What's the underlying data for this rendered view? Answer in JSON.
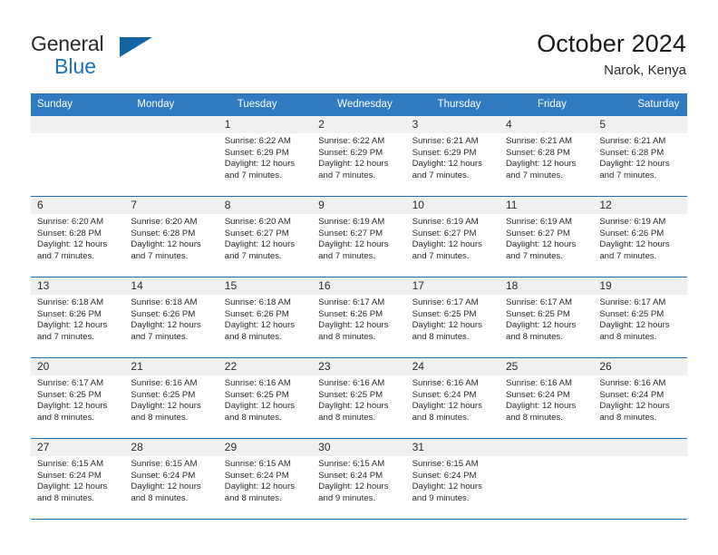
{
  "brand": {
    "name_part1": "General",
    "name_part2": "Blue",
    "triangle_icon": "blue-triangle-logo-mark",
    "accent_color": "#1d72b8"
  },
  "header": {
    "title": "October 2024",
    "subtitle": "Narok, Kenya"
  },
  "theme": {
    "header_row_color": "#2f7ac1",
    "row_divider_color": "#1f6fb5",
    "date_band_color": "#f0f0f0",
    "text_color": "#2b2b2b"
  },
  "weekday_headers": [
    "Sunday",
    "Monday",
    "Tuesday",
    "Wednesday",
    "Thursday",
    "Friday",
    "Saturday"
  ],
  "weeks": [
    [
      {
        "day": "",
        "empty": true,
        "sunrise": "",
        "sunset": "",
        "daylight1": "",
        "daylight2": ""
      },
      {
        "day": "",
        "empty": true,
        "sunrise": "",
        "sunset": "",
        "daylight1": "",
        "daylight2": ""
      },
      {
        "day": "1",
        "sunrise": "Sunrise: 6:22 AM",
        "sunset": "Sunset: 6:29 PM",
        "daylight1": "Daylight: 12 hours",
        "daylight2": "and 7 minutes."
      },
      {
        "day": "2",
        "sunrise": "Sunrise: 6:22 AM",
        "sunset": "Sunset: 6:29 PM",
        "daylight1": "Daylight: 12 hours",
        "daylight2": "and 7 minutes."
      },
      {
        "day": "3",
        "sunrise": "Sunrise: 6:21 AM",
        "sunset": "Sunset: 6:29 PM",
        "daylight1": "Daylight: 12 hours",
        "daylight2": "and 7 minutes."
      },
      {
        "day": "4",
        "sunrise": "Sunrise: 6:21 AM",
        "sunset": "Sunset: 6:28 PM",
        "daylight1": "Daylight: 12 hours",
        "daylight2": "and 7 minutes."
      },
      {
        "day": "5",
        "sunrise": "Sunrise: 6:21 AM",
        "sunset": "Sunset: 6:28 PM",
        "daylight1": "Daylight: 12 hours",
        "daylight2": "and 7 minutes."
      }
    ],
    [
      {
        "day": "6",
        "sunrise": "Sunrise: 6:20 AM",
        "sunset": "Sunset: 6:28 PM",
        "daylight1": "Daylight: 12 hours",
        "daylight2": "and 7 minutes."
      },
      {
        "day": "7",
        "sunrise": "Sunrise: 6:20 AM",
        "sunset": "Sunset: 6:28 PM",
        "daylight1": "Daylight: 12 hours",
        "daylight2": "and 7 minutes."
      },
      {
        "day": "8",
        "sunrise": "Sunrise: 6:20 AM",
        "sunset": "Sunset: 6:27 PM",
        "daylight1": "Daylight: 12 hours",
        "daylight2": "and 7 minutes."
      },
      {
        "day": "9",
        "sunrise": "Sunrise: 6:19 AM",
        "sunset": "Sunset: 6:27 PM",
        "daylight1": "Daylight: 12 hours",
        "daylight2": "and 7 minutes."
      },
      {
        "day": "10",
        "sunrise": "Sunrise: 6:19 AM",
        "sunset": "Sunset: 6:27 PM",
        "daylight1": "Daylight: 12 hours",
        "daylight2": "and 7 minutes."
      },
      {
        "day": "11",
        "sunrise": "Sunrise: 6:19 AM",
        "sunset": "Sunset: 6:27 PM",
        "daylight1": "Daylight: 12 hours",
        "daylight2": "and 7 minutes."
      },
      {
        "day": "12",
        "sunrise": "Sunrise: 6:19 AM",
        "sunset": "Sunset: 6:26 PM",
        "daylight1": "Daylight: 12 hours",
        "daylight2": "and 7 minutes."
      }
    ],
    [
      {
        "day": "13",
        "sunrise": "Sunrise: 6:18 AM",
        "sunset": "Sunset: 6:26 PM",
        "daylight1": "Daylight: 12 hours",
        "daylight2": "and 7 minutes."
      },
      {
        "day": "14",
        "sunrise": "Sunrise: 6:18 AM",
        "sunset": "Sunset: 6:26 PM",
        "daylight1": "Daylight: 12 hours",
        "daylight2": "and 7 minutes."
      },
      {
        "day": "15",
        "sunrise": "Sunrise: 6:18 AM",
        "sunset": "Sunset: 6:26 PM",
        "daylight1": "Daylight: 12 hours",
        "daylight2": "and 8 minutes."
      },
      {
        "day": "16",
        "sunrise": "Sunrise: 6:17 AM",
        "sunset": "Sunset: 6:26 PM",
        "daylight1": "Daylight: 12 hours",
        "daylight2": "and 8 minutes."
      },
      {
        "day": "17",
        "sunrise": "Sunrise: 6:17 AM",
        "sunset": "Sunset: 6:25 PM",
        "daylight1": "Daylight: 12 hours",
        "daylight2": "and 8 minutes."
      },
      {
        "day": "18",
        "sunrise": "Sunrise: 6:17 AM",
        "sunset": "Sunset: 6:25 PM",
        "daylight1": "Daylight: 12 hours",
        "daylight2": "and 8 minutes."
      },
      {
        "day": "19",
        "sunrise": "Sunrise: 6:17 AM",
        "sunset": "Sunset: 6:25 PM",
        "daylight1": "Daylight: 12 hours",
        "daylight2": "and 8 minutes."
      }
    ],
    [
      {
        "day": "20",
        "sunrise": "Sunrise: 6:17 AM",
        "sunset": "Sunset: 6:25 PM",
        "daylight1": "Daylight: 12 hours",
        "daylight2": "and 8 minutes."
      },
      {
        "day": "21",
        "sunrise": "Sunrise: 6:16 AM",
        "sunset": "Sunset: 6:25 PM",
        "daylight1": "Daylight: 12 hours",
        "daylight2": "and 8 minutes."
      },
      {
        "day": "22",
        "sunrise": "Sunrise: 6:16 AM",
        "sunset": "Sunset: 6:25 PM",
        "daylight1": "Daylight: 12 hours",
        "daylight2": "and 8 minutes."
      },
      {
        "day": "23",
        "sunrise": "Sunrise: 6:16 AM",
        "sunset": "Sunset: 6:25 PM",
        "daylight1": "Daylight: 12 hours",
        "daylight2": "and 8 minutes."
      },
      {
        "day": "24",
        "sunrise": "Sunrise: 6:16 AM",
        "sunset": "Sunset: 6:24 PM",
        "daylight1": "Daylight: 12 hours",
        "daylight2": "and 8 minutes."
      },
      {
        "day": "25",
        "sunrise": "Sunrise: 6:16 AM",
        "sunset": "Sunset: 6:24 PM",
        "daylight1": "Daylight: 12 hours",
        "daylight2": "and 8 minutes."
      },
      {
        "day": "26",
        "sunrise": "Sunrise: 6:16 AM",
        "sunset": "Sunset: 6:24 PM",
        "daylight1": "Daylight: 12 hours",
        "daylight2": "and 8 minutes."
      }
    ],
    [
      {
        "day": "27",
        "sunrise": "Sunrise: 6:15 AM",
        "sunset": "Sunset: 6:24 PM",
        "daylight1": "Daylight: 12 hours",
        "daylight2": "and 8 minutes."
      },
      {
        "day": "28",
        "sunrise": "Sunrise: 6:15 AM",
        "sunset": "Sunset: 6:24 PM",
        "daylight1": "Daylight: 12 hours",
        "daylight2": "and 8 minutes."
      },
      {
        "day": "29",
        "sunrise": "Sunrise: 6:15 AM",
        "sunset": "Sunset: 6:24 PM",
        "daylight1": "Daylight: 12 hours",
        "daylight2": "and 8 minutes."
      },
      {
        "day": "30",
        "sunrise": "Sunrise: 6:15 AM",
        "sunset": "Sunset: 6:24 PM",
        "daylight1": "Daylight: 12 hours",
        "daylight2": "and 9 minutes."
      },
      {
        "day": "31",
        "sunrise": "Sunrise: 6:15 AM",
        "sunset": "Sunset: 6:24 PM",
        "daylight1": "Daylight: 12 hours",
        "daylight2": "and 9 minutes."
      },
      {
        "day": "",
        "empty": true,
        "sunrise": "",
        "sunset": "",
        "daylight1": "",
        "daylight2": ""
      },
      {
        "day": "",
        "empty": true,
        "sunrise": "",
        "sunset": "",
        "daylight1": "",
        "daylight2": ""
      }
    ]
  ]
}
